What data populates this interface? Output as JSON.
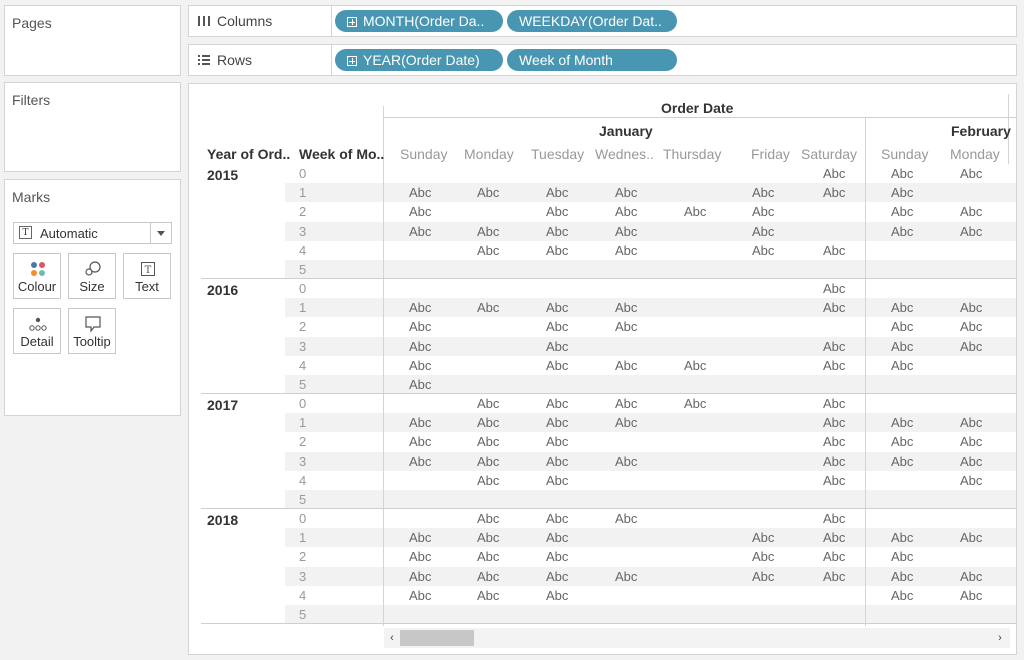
{
  "panels": {
    "pages": "Pages",
    "filters": "Filters",
    "marks": "Marks"
  },
  "marks": {
    "type": "Automatic",
    "buttons": [
      {
        "id": "colour",
        "label": "Colour"
      },
      {
        "id": "size",
        "label": "Size"
      },
      {
        "id": "text",
        "label": "Text"
      },
      {
        "id": "detail",
        "label": "Detail"
      },
      {
        "id": "tooltip",
        "label": "Tooltip"
      }
    ]
  },
  "shelves": {
    "columns": {
      "label": "Columns",
      "pills": [
        "MONTH(Order Da..",
        "WEEKDAY(Order Dat.."
      ]
    },
    "rows": {
      "label": "Rows",
      "pills": [
        "YEAR(Order Date)",
        "Week of Month"
      ]
    }
  },
  "viz": {
    "title": "Order Date",
    "row_headers": [
      "Year of Ord..",
      "Week of Mo.."
    ],
    "months": [
      "January",
      "February"
    ],
    "days": [
      "Sunday",
      "Monday",
      "Tuesday",
      "Wednes..",
      "Thursday",
      "Friday",
      "Saturday"
    ],
    "days_feb": [
      "Sunday",
      "Monday"
    ],
    "cell_text": "Abc",
    "weeks": [
      "0",
      "1",
      "2",
      "3",
      "4",
      "5"
    ],
    "years": [
      {
        "year": "2015",
        "jan": [
          [
            0,
            0,
            0,
            0,
            0,
            0,
            1
          ],
          [
            1,
            1,
            1,
            1,
            0,
            1,
            1
          ],
          [
            1,
            0,
            1,
            1,
            1,
            1,
            0
          ],
          [
            1,
            1,
            1,
            1,
            0,
            1,
            0
          ],
          [
            0,
            1,
            1,
            1,
            0,
            1,
            1
          ],
          [
            0,
            0,
            0,
            0,
            0,
            0,
            0
          ]
        ],
        "feb": [
          [
            1,
            1
          ],
          [
            1,
            0
          ],
          [
            1,
            1
          ],
          [
            1,
            1
          ],
          [
            0,
            0
          ],
          [
            0,
            0
          ]
        ]
      },
      {
        "year": "2016",
        "jan": [
          [
            0,
            0,
            0,
            0,
            0,
            0,
            1
          ],
          [
            1,
            1,
            1,
            1,
            0,
            0,
            1
          ],
          [
            1,
            0,
            1,
            1,
            0,
            0,
            0
          ],
          [
            1,
            0,
            1,
            0,
            0,
            0,
            1
          ],
          [
            1,
            0,
            1,
            1,
            1,
            0,
            1
          ],
          [
            1,
            0,
            0,
            0,
            0,
            0,
            0
          ]
        ],
        "feb": [
          [
            0,
            0
          ],
          [
            1,
            1
          ],
          [
            1,
            1
          ],
          [
            1,
            1
          ],
          [
            1,
            0
          ],
          [
            0,
            0
          ]
        ]
      },
      {
        "year": "2017",
        "jan": [
          [
            0,
            1,
            1,
            1,
            1,
            0,
            1
          ],
          [
            1,
            1,
            1,
            1,
            0,
            0,
            1
          ],
          [
            1,
            1,
            1,
            0,
            0,
            0,
            1
          ],
          [
            1,
            1,
            1,
            1,
            0,
            0,
            1
          ],
          [
            0,
            1,
            1,
            0,
            0,
            0,
            1
          ],
          [
            0,
            0,
            0,
            0,
            0,
            0,
            0
          ]
        ],
        "feb": [
          [
            0,
            0
          ],
          [
            1,
            1
          ],
          [
            1,
            1
          ],
          [
            1,
            1
          ],
          [
            0,
            1
          ],
          [
            0,
            0
          ]
        ]
      },
      {
        "year": "2018",
        "jan": [
          [
            0,
            1,
            1,
            1,
            0,
            0,
            1
          ],
          [
            1,
            1,
            1,
            0,
            0,
            1,
            1
          ],
          [
            1,
            1,
            1,
            0,
            0,
            1,
            1
          ],
          [
            1,
            1,
            1,
            1,
            0,
            1,
            1
          ],
          [
            1,
            1,
            1,
            0,
            0,
            0,
            0
          ],
          [
            0,
            0,
            0,
            0,
            0,
            0,
            0
          ]
        ],
        "feb": [
          [
            0,
            0
          ],
          [
            1,
            1
          ],
          [
            1,
            0
          ],
          [
            1,
            1
          ],
          [
            1,
            1
          ],
          [
            0,
            0
          ]
        ]
      }
    ]
  },
  "colors": {
    "pill": "#4996b2",
    "band": "#f2f2f2",
    "accent_red": "#e15759",
    "accent_blue": "#4e79a7"
  }
}
